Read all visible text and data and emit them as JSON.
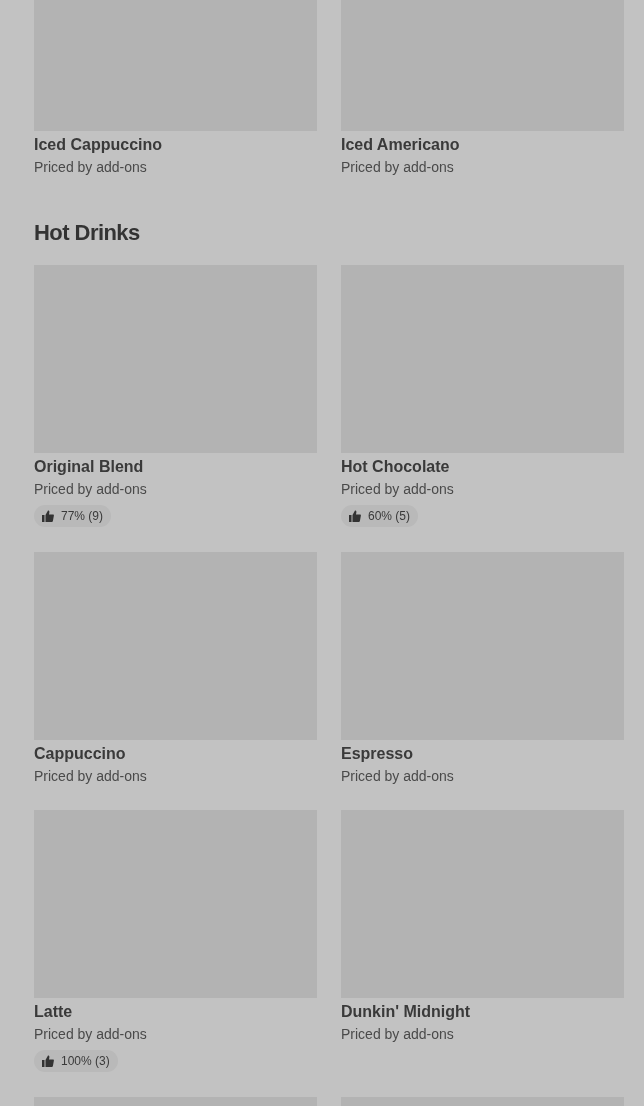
{
  "sections": [
    {
      "items": [
        {
          "kind": "card",
          "title": "Iced Cappuccino",
          "subtitle": "Priced by add-ons"
        },
        {
          "kind": "card",
          "title": "Iced Americano",
          "subtitle": "Priced by add-ons"
        }
      ]
    },
    {
      "heading": "Hot Drinks",
      "items": [
        {
          "kind": "card",
          "title": "Original Blend",
          "subtitle": "Priced by add-ons",
          "rating": "77% (9)"
        },
        {
          "kind": "card",
          "title": "Hot Chocolate",
          "subtitle": "Priced by add-ons",
          "rating": "60% (5)"
        },
        {
          "kind": "card",
          "title": "Cappuccino",
          "subtitle": "Priced by add-ons"
        },
        {
          "kind": "card",
          "title": "Espresso",
          "subtitle": "Priced by add-ons"
        },
        {
          "kind": "card",
          "title": "Latte",
          "subtitle": "Priced by add-ons",
          "rating": "100% (3)"
        },
        {
          "kind": "card",
          "title": "Dunkin' Midnight",
          "subtitle": "Priced by add-ons"
        },
        {
          "kind": "cut_off"
        },
        {
          "kind": "cut_off"
        }
      ]
    }
  ]
}
